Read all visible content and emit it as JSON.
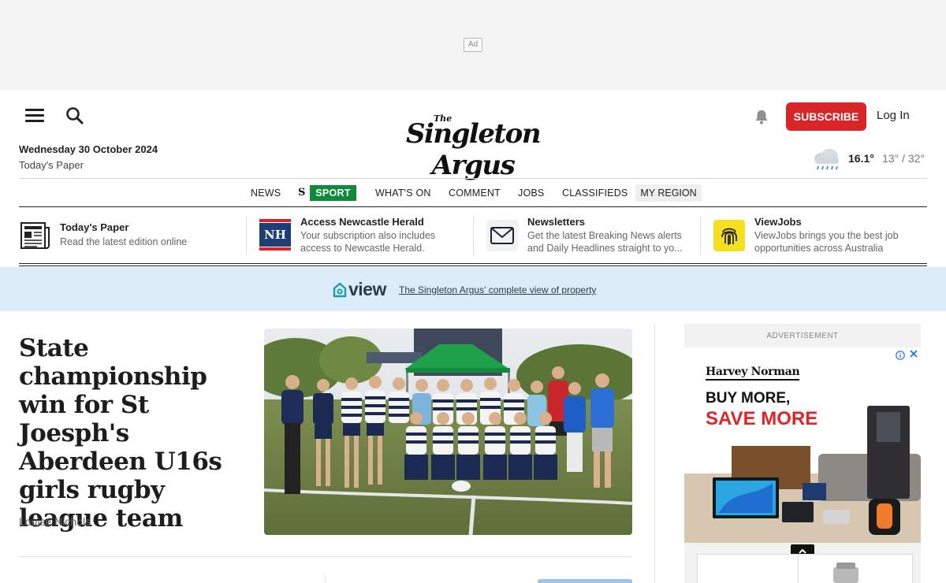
{
  "ad_top": {
    "badge": "Ad"
  },
  "header": {
    "date": "Wednesday 30 October 2024",
    "todays_paper": "Today's Paper",
    "logo_the": "The",
    "logo_name": "Singleton Argus",
    "subscribe": "SUBSCRIBE",
    "login": "Log In",
    "weather": {
      "icon": "rain-cloud-icon",
      "current": "16.1°",
      "range": "13° / 32°"
    }
  },
  "nav": {
    "items": [
      "NEWS",
      "SPORT",
      "WHAT'S ON",
      "COMMENT",
      "JOBS",
      "CLASSIFIEDS",
      "MY REGION"
    ],
    "sport_letter": "S",
    "sport_color": "#0e8a3a"
  },
  "promos": [
    {
      "title": "Today's Paper",
      "desc": "Read the latest edition online",
      "icon": "newspaper-icon"
    },
    {
      "title": "Access Newcastle Herald",
      "desc": "Your subscription also includes access to Newcastle Herald.",
      "icon": "nh-logo-icon",
      "icon_text": "NH"
    },
    {
      "title": "Newsletters",
      "desc": "Get the latest Breaking News alerts and Daily Headlines straight to yo...",
      "icon": "envelope-icon"
    },
    {
      "title": "ViewJobs",
      "desc": "ViewJobs brings you the best job opportunities across Australia",
      "icon": "fingerprint-icon"
    }
  ],
  "view_banner": {
    "brand": "view",
    "link": "The Singleton Argus' complete view of property"
  },
  "article": {
    "headline": "State championship win for St Joesph's Aberdeen U16s girls rugby league team",
    "author": "Louise Nichols"
  },
  "side_ad": {
    "label": "ADVERTISEMENT",
    "brand": "Harvey Norman",
    "line1": "BUY MORE,",
    "line2": "SAVE MORE"
  },
  "colors": {
    "subscribe": "#d9252a",
    "sport": "#0e8a3a",
    "banner_bg": "#dcecf8",
    "ad_red": "#e2232a"
  }
}
